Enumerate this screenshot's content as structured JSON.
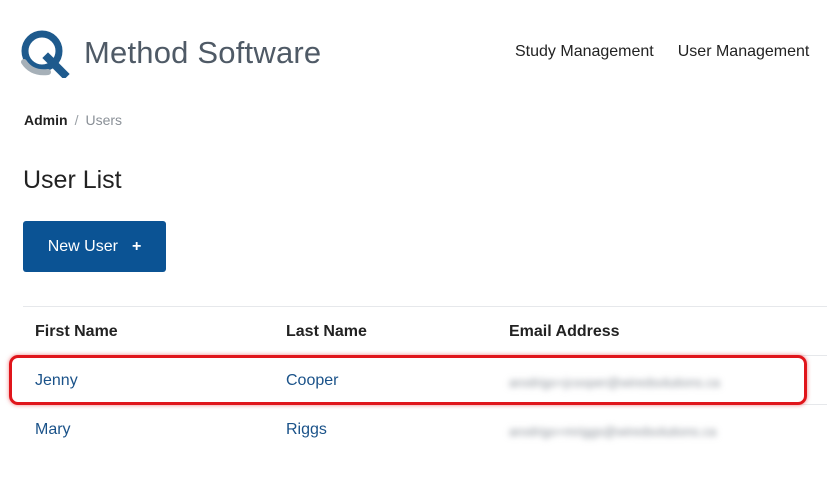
{
  "brand": {
    "name": "Method Software",
    "colors": {
      "primary": "#0b5394",
      "logo_blue": "#1e5a8d",
      "logo_gray": "#a6b0b8",
      "highlight": "#e0151b"
    }
  },
  "nav": {
    "items": [
      "Study Management",
      "User Management"
    ]
  },
  "breadcrumb": {
    "root": "Admin",
    "separator": "/",
    "current": "Users"
  },
  "page": {
    "title": "User List"
  },
  "actions": {
    "new_user_label": "New User",
    "new_user_icon": "+"
  },
  "table": {
    "columns": [
      "First Name",
      "Last Name",
      "Email Address"
    ],
    "rows": [
      {
        "first": "Jenny",
        "last": "Cooper",
        "email": "arodrigo+jcooper@wiredsolutions.ca"
      },
      {
        "first": "Mary",
        "last": "Riggs",
        "email": "arodrigo+mriggs@wiredsolutions.ca"
      }
    ]
  }
}
